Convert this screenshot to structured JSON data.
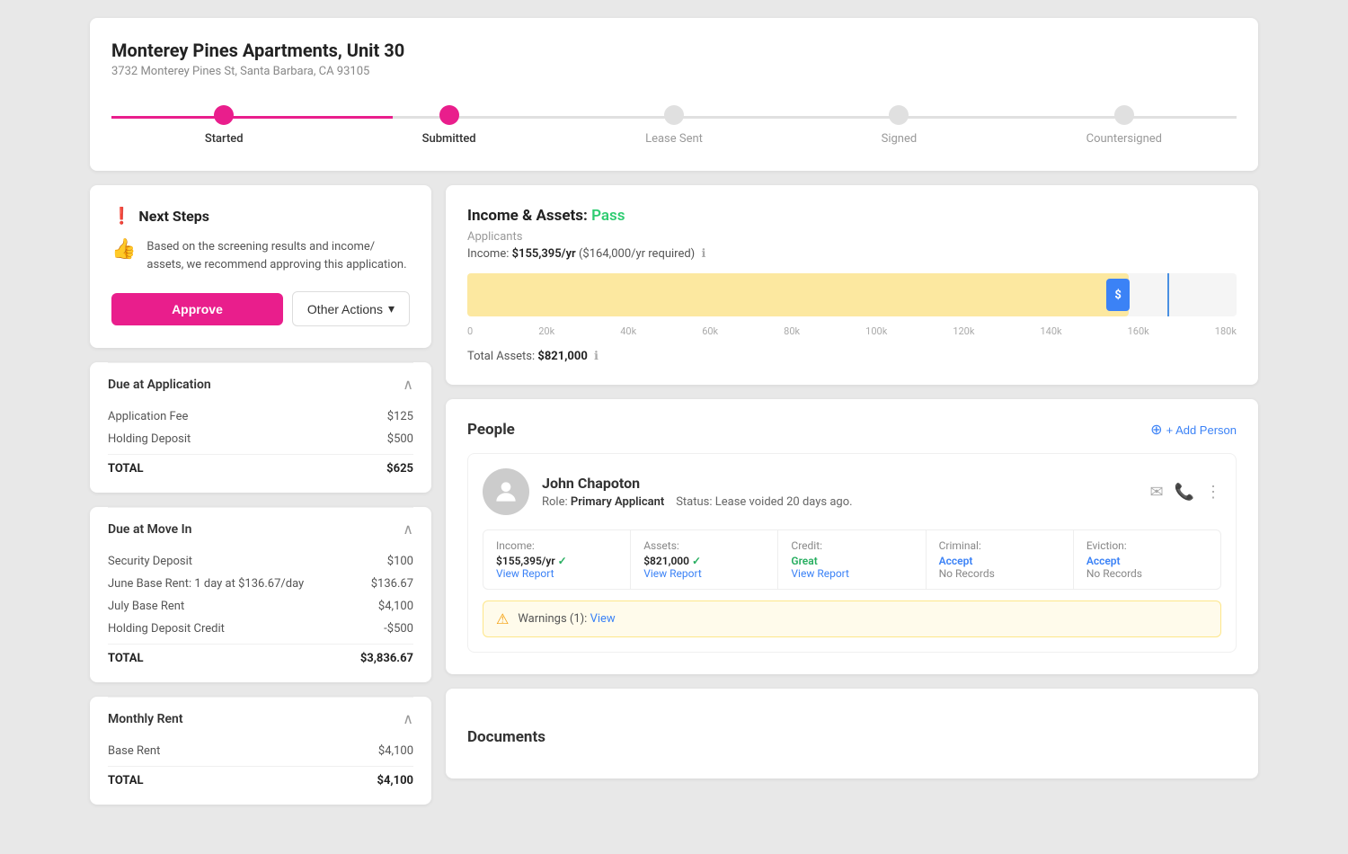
{
  "header": {
    "property_name": "Monterey Pines Apartments, Unit 30",
    "address": "3732 Monterey Pines St, Santa Barbara, CA 93105"
  },
  "progress": {
    "steps": [
      {
        "id": "started",
        "label": "Started",
        "active": true
      },
      {
        "id": "submitted",
        "label": "Submitted",
        "active": true
      },
      {
        "id": "lease_sent",
        "label": "Lease Sent",
        "active": false
      },
      {
        "id": "signed",
        "label": "Signed",
        "active": false
      },
      {
        "id": "countersigned",
        "label": "Countersigned",
        "active": false
      }
    ]
  },
  "next_steps": {
    "title": "Next Steps",
    "description": "Based on the screening results and income/ assets, we recommend approving this application.",
    "approve_label": "Approve",
    "other_actions_label": "Other Actions"
  },
  "due_at_application": {
    "title": "Due at Application",
    "items": [
      {
        "label": "Application Fee",
        "value": "$125"
      },
      {
        "label": "Holding Deposit",
        "value": "$500"
      }
    ],
    "total_label": "TOTAL",
    "total_value": "$625"
  },
  "due_at_move_in": {
    "title": "Due at Move In",
    "items": [
      {
        "label": "Security Deposit",
        "value": "$100"
      },
      {
        "label": "June Base Rent: 1 day at $136.67/day",
        "value": "$136.67"
      },
      {
        "label": "July Base Rent",
        "value": "$4,100"
      },
      {
        "label": "Holding Deposit Credit",
        "value": "-$500"
      }
    ],
    "total_label": "TOTAL",
    "total_value": "$3,836.67"
  },
  "monthly_rent": {
    "title": "Monthly Rent",
    "items": [
      {
        "label": "Base Rent",
        "value": "$4,100"
      }
    ],
    "total_label": "TOTAL",
    "total_value": "$4,100"
  },
  "income_assets": {
    "title": "Income & Assets:",
    "status": "Pass",
    "applicants_label": "Applicants",
    "income_text": "Income: ",
    "income_value": "$155,395/yr",
    "income_required": "($164,000/yr required)",
    "bar": {
      "fill_percent": 86,
      "required_percent": 91,
      "axis_labels": [
        "0",
        "20k",
        "40k",
        "60k",
        "80k",
        "100k",
        "120k",
        "140k",
        "160k",
        "180k"
      ]
    },
    "total_assets_label": "Total Assets: ",
    "total_assets_value": "$821,000"
  },
  "people": {
    "title": "People",
    "add_person_label": "+ Add Person",
    "person": {
      "name": "John Chapoton",
      "role_label": "Role: ",
      "role": "Primary Applicant",
      "status_label": "Status: ",
      "status": "Lease voided 20 days ago.",
      "stats": [
        {
          "label": "Income:",
          "value": "$155,395/yr",
          "check": true,
          "link": "View Report"
        },
        {
          "label": "Assets:",
          "value": "$821,000",
          "check": true,
          "link": "View Report"
        },
        {
          "label": "Credit:",
          "qualifier": "Great",
          "qualifier_color": "green",
          "link": "View Report"
        },
        {
          "label": "Criminal:",
          "qualifier": "Accept",
          "qualifier_color": "blue",
          "sub": "No Records"
        },
        {
          "label": "Eviction:",
          "qualifier": "Accept",
          "qualifier_color": "blue",
          "sub": "No Records"
        }
      ],
      "warning": {
        "text": "Warnings (1): ",
        "link": "View"
      }
    }
  },
  "documents": {
    "title": "Documents"
  }
}
